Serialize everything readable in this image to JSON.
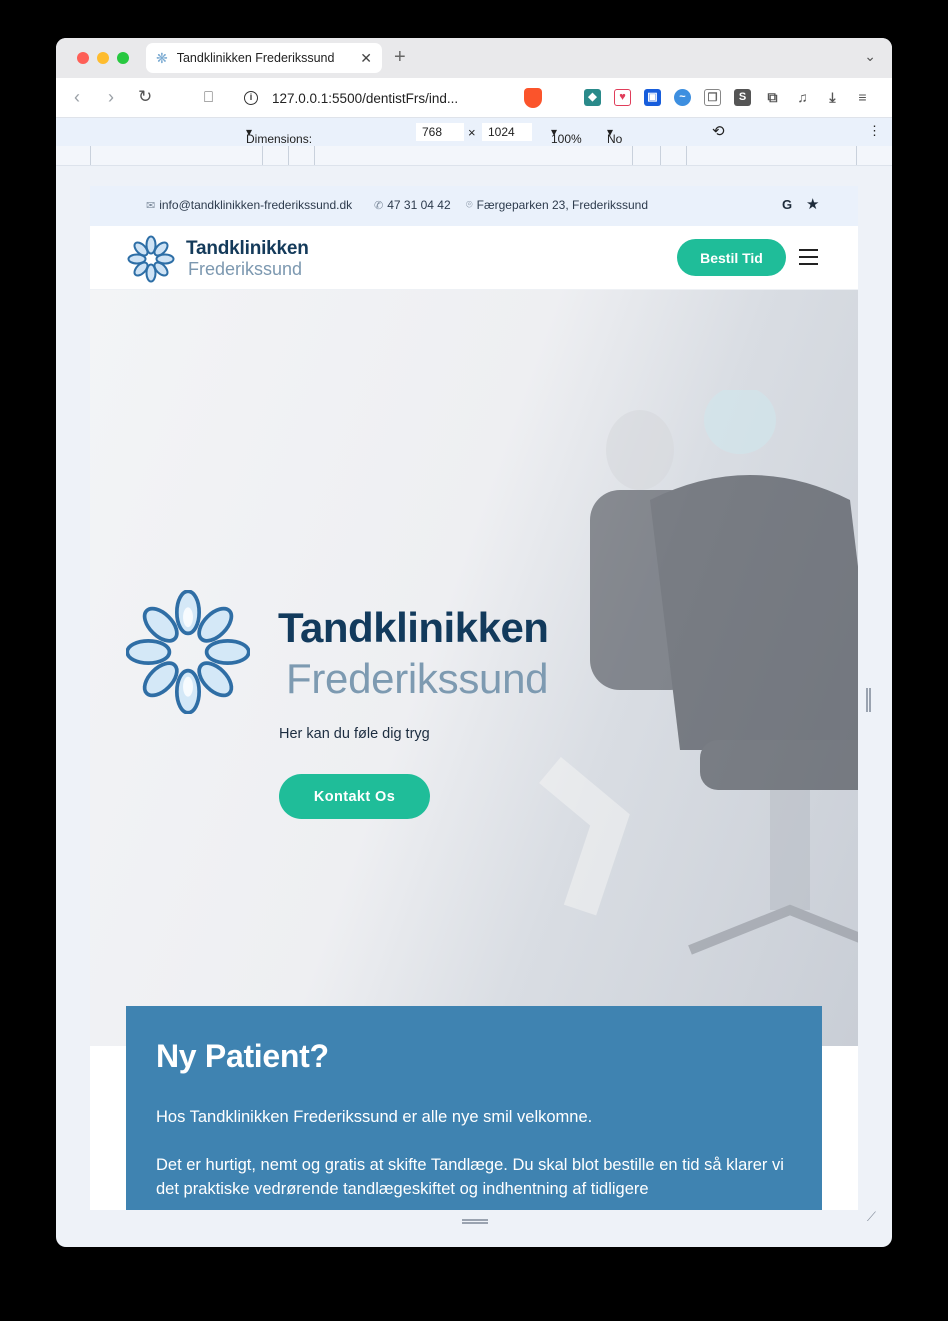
{
  "browser": {
    "tab_title": "Tandklinikken Frederikssund",
    "url": "127.0.0.1:5500/dentistFrs/ind...",
    "extension_s_label": "S"
  },
  "devtools": {
    "dimensions_label": "Dimensions: Responsive",
    "width": "768",
    "height": "1024",
    "times_symbol": "×",
    "zoom": "100%",
    "throttling": "No throttling"
  },
  "site": {
    "contact": {
      "email": "info@tandklinikken-frederikssund.dk",
      "phone": "47 31 04 42",
      "address": "Færgeparken 23, Frederikssund",
      "google_label": "G"
    },
    "header": {
      "brand_line1": "Tandklinikken",
      "brand_line2": "Frederikssund",
      "book_button": "Bestil Tid"
    },
    "hero": {
      "title_line1": "Tandklinikken",
      "title_line2": "Frederikssund",
      "tagline": "Her kan du føle dig tryg",
      "cta": "Kontakt Os"
    },
    "new_patient": {
      "heading": "Ny Patient?",
      "paragraph1": "Hos Tandklinikken Frederikssund er alle nye smil velkomne.",
      "paragraph2": "Det er hurtigt, nemt og gratis at skifte Tandlæge. Du skal blot bestille en tid så klarer vi det praktiske vedrørende tandlægeskiftet og indhentning af tidligere"
    }
  }
}
